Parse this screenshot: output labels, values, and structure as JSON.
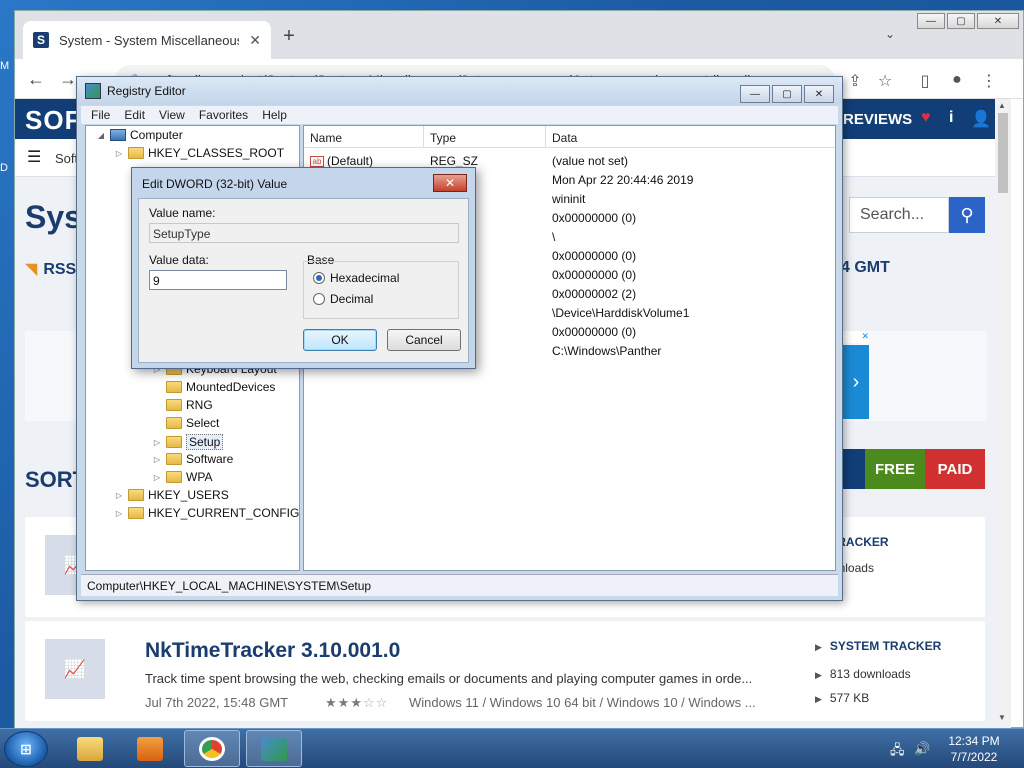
{
  "desktop": {
    "left_glyph_1": "M",
    "left_glyph_2": "D"
  },
  "browser": {
    "tab_title": "System - System Miscellaneous D",
    "tab_favicon": "S",
    "new_tab": "+",
    "tab_dropdown": "⌄",
    "url": "softpedia.com/get/System/System-Miscellaneous/?utm_source=spd&utm_campaign=postdl_redir",
    "window_controls": {
      "minimize": "—",
      "maximize": "▢",
      "close": "✕"
    }
  },
  "page": {
    "logo": "SOFT",
    "reviews": "REVIEWS",
    "subnav": "Soft",
    "title": "Sys",
    "rss": "RSS",
    "search_placeholder": "Search...",
    "gmt": "4 GMT",
    "ad_close": "✕",
    "sort": "SORT",
    "segment_free": "FREE",
    "segment_paid": "PAID",
    "colors": {
      "free": "#4d8a1e",
      "paid": "#d03030",
      "nav": "#123e78"
    },
    "cards": [
      {
        "category": "TRACKER",
        "downloads": "wnloads"
      },
      {
        "title": "NkTimeTracker 3.10.001.0",
        "description": "Track time spent browsing the web, checking emails or documents and playing computer games in orde...",
        "date": "Jul 7th 2022, 15:48 GMT",
        "rating": 3,
        "rating_max": 5,
        "os": "Windows 11 / Windows 10 64 bit / Windows 10 / Windows ...",
        "category": "SYSTEM TRACKER",
        "downloads": "813 downloads",
        "size": "577 KB"
      }
    ]
  },
  "regedit": {
    "title": "Registry Editor",
    "menu": [
      "File",
      "Edit",
      "View",
      "Favorites",
      "Help"
    ],
    "tree": [
      {
        "label": "Computer",
        "expander": "◢",
        "icon": "computer"
      },
      {
        "label": "HKEY_CLASSES_ROOT",
        "expander": "▷",
        "icon": "folder"
      },
      {
        "label": "Keyboard Layout",
        "expander": "▷",
        "icon": "folder"
      },
      {
        "label": "MountedDevices",
        "expander": "",
        "icon": "folder"
      },
      {
        "label": "RNG",
        "expander": "",
        "icon": "folder"
      },
      {
        "label": "Select",
        "expander": "",
        "icon": "folder"
      },
      {
        "label": "Setup",
        "expander": "▷",
        "icon": "folder",
        "selected": true
      },
      {
        "label": "Software",
        "expander": "▷",
        "icon": "folder"
      },
      {
        "label": "WPA",
        "expander": "▷",
        "icon": "folder"
      },
      {
        "label": "HKEY_USERS",
        "expander": "▷",
        "icon": "folder"
      },
      {
        "label": "HKEY_CURRENT_CONFIG",
        "expander": "▷",
        "icon": "folder"
      }
    ],
    "columns": [
      "Name",
      "Type",
      "Data"
    ],
    "rows": [
      {
        "name": "(Default)",
        "type": "REG_SZ",
        "data": "(value not set)"
      },
      {
        "name": "",
        "type": "LTI_SZ",
        "data": "Mon Apr 22 20:44:46 2019"
      },
      {
        "name": "",
        "type": "",
        "data": "wininit"
      },
      {
        "name": "",
        "type": "ORD",
        "data": "0x00000000 (0)"
      },
      {
        "name": "",
        "type": "",
        "data": "\\"
      },
      {
        "name": "",
        "type": "ORD",
        "data": "0x00000000 (0)"
      },
      {
        "name": "",
        "type": "ORD",
        "data": "0x00000000 (0)"
      },
      {
        "name": "",
        "type": "ORD",
        "data": "0x00000002 (2)"
      },
      {
        "name": "",
        "type": "",
        "data": "\\Device\\HarddiskVolume1"
      },
      {
        "name": "",
        "type": "ORD",
        "data": "0x00000000 (0)"
      },
      {
        "name": "",
        "type": "",
        "data": "C:\\Windows\\Panther"
      }
    ],
    "status": "Computer\\HKEY_LOCAL_MACHINE\\SYSTEM\\Setup",
    "window_controls": {
      "minimize": "—",
      "maximize": "▢",
      "close": "✕"
    }
  },
  "dialog": {
    "title": "Edit DWORD (32-bit) Value",
    "value_name_label": "Value name:",
    "value_name": "SetupType",
    "value_data_label": "Value data:",
    "value_data": "9",
    "base_label": "Base",
    "base_options": [
      "Hexadecimal",
      "Decimal"
    ],
    "base_selected": "Hexadecimal",
    "ok": "OK",
    "cancel": "Cancel",
    "close": "✕"
  },
  "taskbar": {
    "start": "⊞",
    "time": "12:34 PM",
    "date": "7/7/2022"
  }
}
